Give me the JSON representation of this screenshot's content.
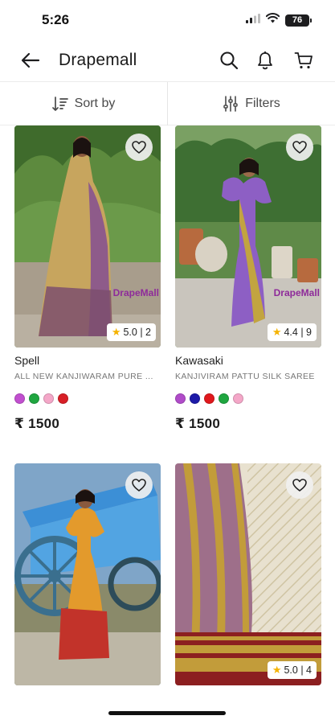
{
  "status": {
    "time": "5:26",
    "battery": "76"
  },
  "header": {
    "title": "Drapemall"
  },
  "toolbar": {
    "sort_label": "Sort by",
    "filter_label": "Filters"
  },
  "products": [
    {
      "brand": "Spell",
      "description": "ALL NEW KANJIWARAM PURE ...",
      "rating": "5.0 | 2",
      "price": "₹ 1500",
      "colors": [
        "#c14fcf",
        "#1fa640",
        "#f4a7c8",
        "#d81f26"
      ],
      "watermark": "DrapeMall"
    },
    {
      "brand": "Kawasaki",
      "description": "KANJIVIRAM PATTU SILK SAREE",
      "rating": "4.4 | 9",
      "price": "₹ 1500",
      "colors": [
        "#b04bc9",
        "#1d1aa8",
        "#e0181c",
        "#1fa640",
        "#f4a7c8"
      ],
      "watermark": "DrapeMall"
    },
    {
      "brand": "",
      "description": "",
      "rating": "",
      "price": "",
      "colors": []
    },
    {
      "brand": "",
      "description": "",
      "rating": "5.0 | 4",
      "price": "",
      "colors": []
    }
  ]
}
